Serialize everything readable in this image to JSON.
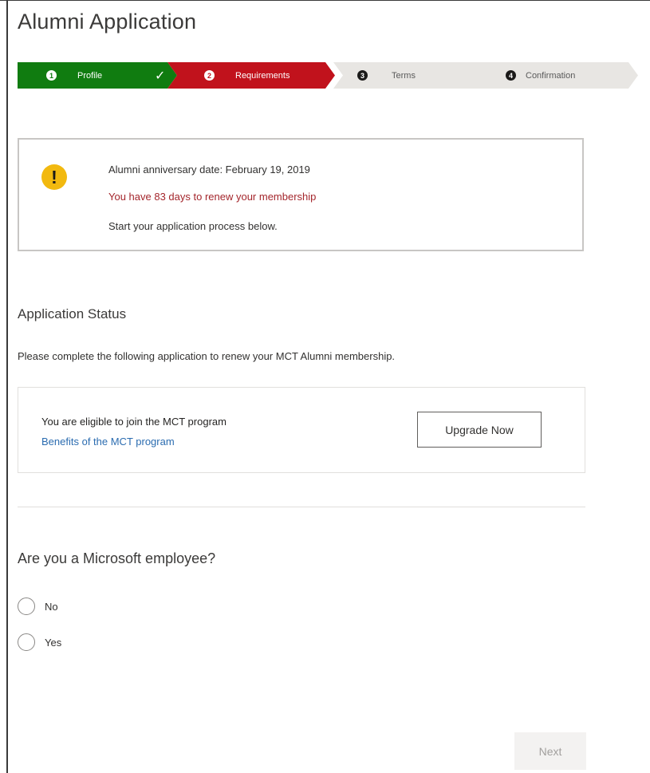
{
  "page": {
    "title": "Alumni Application"
  },
  "wizard": {
    "steps": [
      {
        "number": "1",
        "label": "Profile",
        "state": "completed",
        "mark": "✓"
      },
      {
        "number": "2",
        "label": "Requirements",
        "state": "current"
      },
      {
        "number": "3",
        "label": "Terms",
        "state": "upcoming"
      },
      {
        "number": "4",
        "label": "Confirmation",
        "state": "upcoming"
      }
    ]
  },
  "alert": {
    "icon": "warning-icon",
    "icon_glyph": "!",
    "anniversary": "Alumni anniversary date: February 19, 2019",
    "renew_notice": "You have 83 days to renew your membership",
    "instruction": "Start your application process below."
  },
  "status": {
    "title": "Application Status",
    "description": "Please complete the following application to renew your MCT Alumni membership."
  },
  "mct": {
    "eligible_text": "You are eligible to join the MCT program",
    "benefits_link": "Benefits of the MCT program",
    "upgrade_label": "Upgrade Now"
  },
  "question": {
    "text": "Are you a Microsoft employee?",
    "options": [
      "No",
      "Yes"
    ],
    "selected": null
  },
  "footer": {
    "next_label": "Next",
    "next_enabled": false
  },
  "colors": {
    "step_completed": "#107c10",
    "step_current": "#c1121c",
    "step_upcoming": "#e8e6e3",
    "warning": "#f2b90f",
    "alert_text": "#a4262c",
    "link": "#2b6cb0"
  }
}
